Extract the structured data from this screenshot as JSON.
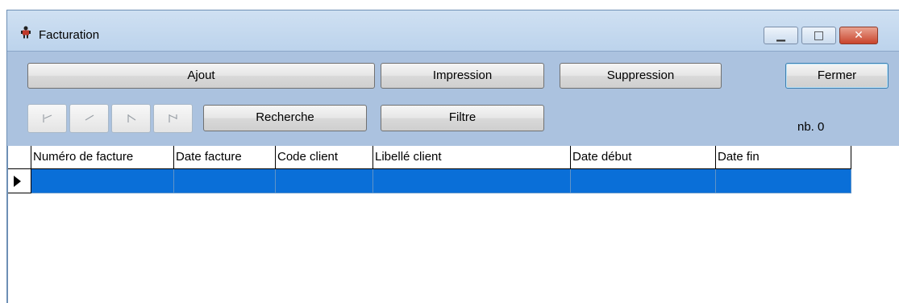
{
  "window": {
    "title": "Facturation",
    "minimize_glyph": "▁",
    "maximize_glyph": "□",
    "close_glyph": "✕"
  },
  "toolbar": {
    "ajout": "Ajout",
    "impression": "Impression",
    "suppression": "Suppression",
    "fermer": "Fermer",
    "recherche": "Recherche",
    "filtre": "Filtre",
    "count_label": "nb. 0"
  },
  "nav": {
    "first_icon": "first-record-icon",
    "prev_icon": "previous-record-icon",
    "next_icon": "next-record-icon",
    "last_icon": "last-record-icon"
  },
  "grid": {
    "columns": [
      "Numéro de facture",
      "Date facture",
      "Code client",
      "Libellé client",
      "Date début",
      "Date fin"
    ],
    "selected_row_color": "#0a6fd8"
  },
  "colors": {
    "panel": "#abc2df",
    "titlebar": "#bcd3ec"
  }
}
